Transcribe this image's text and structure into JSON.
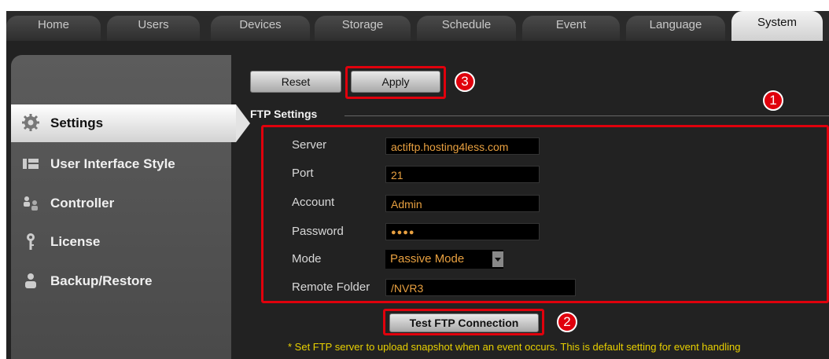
{
  "top_tabs": [
    "Home",
    "Users",
    "Devices",
    "Storage",
    "Schedule",
    "Event",
    "Language",
    "System"
  ],
  "active_tab": "System",
  "sidebar": {
    "items": [
      {
        "label": "Settings",
        "icon": "gear-icon",
        "active": true
      },
      {
        "label": "User Interface Style",
        "icon": "window-icon"
      },
      {
        "label": "Controller",
        "icon": "users-icon"
      },
      {
        "label": "License",
        "icon": "key-icon"
      },
      {
        "label": "Backup/Restore",
        "icon": "user-backup-icon"
      }
    ]
  },
  "toolbar": {
    "reset_label": "Reset",
    "apply_label": "Apply"
  },
  "section_title": "FTP Settings",
  "form": {
    "server_label": "Server",
    "server_value": "actiftp.hosting4less.com",
    "port_label": "Port",
    "port_value": "21",
    "account_label": "Account",
    "account_value": "Admin",
    "password_label": "Password",
    "password_value": "●●●●",
    "mode_label": "Mode",
    "mode_value": "Passive Mode",
    "remote_folder_label": "Remote Folder",
    "remote_folder_value": "/NVR3"
  },
  "test_button_label": "Test FTP Connection",
  "note": "* Set FTP server to upload snapshot when an event occurs. This is default setting for event handling",
  "markers": [
    "1",
    "2",
    "3"
  ],
  "colors": {
    "highlight": "#e0000c",
    "field_text": "#e8a040",
    "note_text": "#e8d000"
  }
}
